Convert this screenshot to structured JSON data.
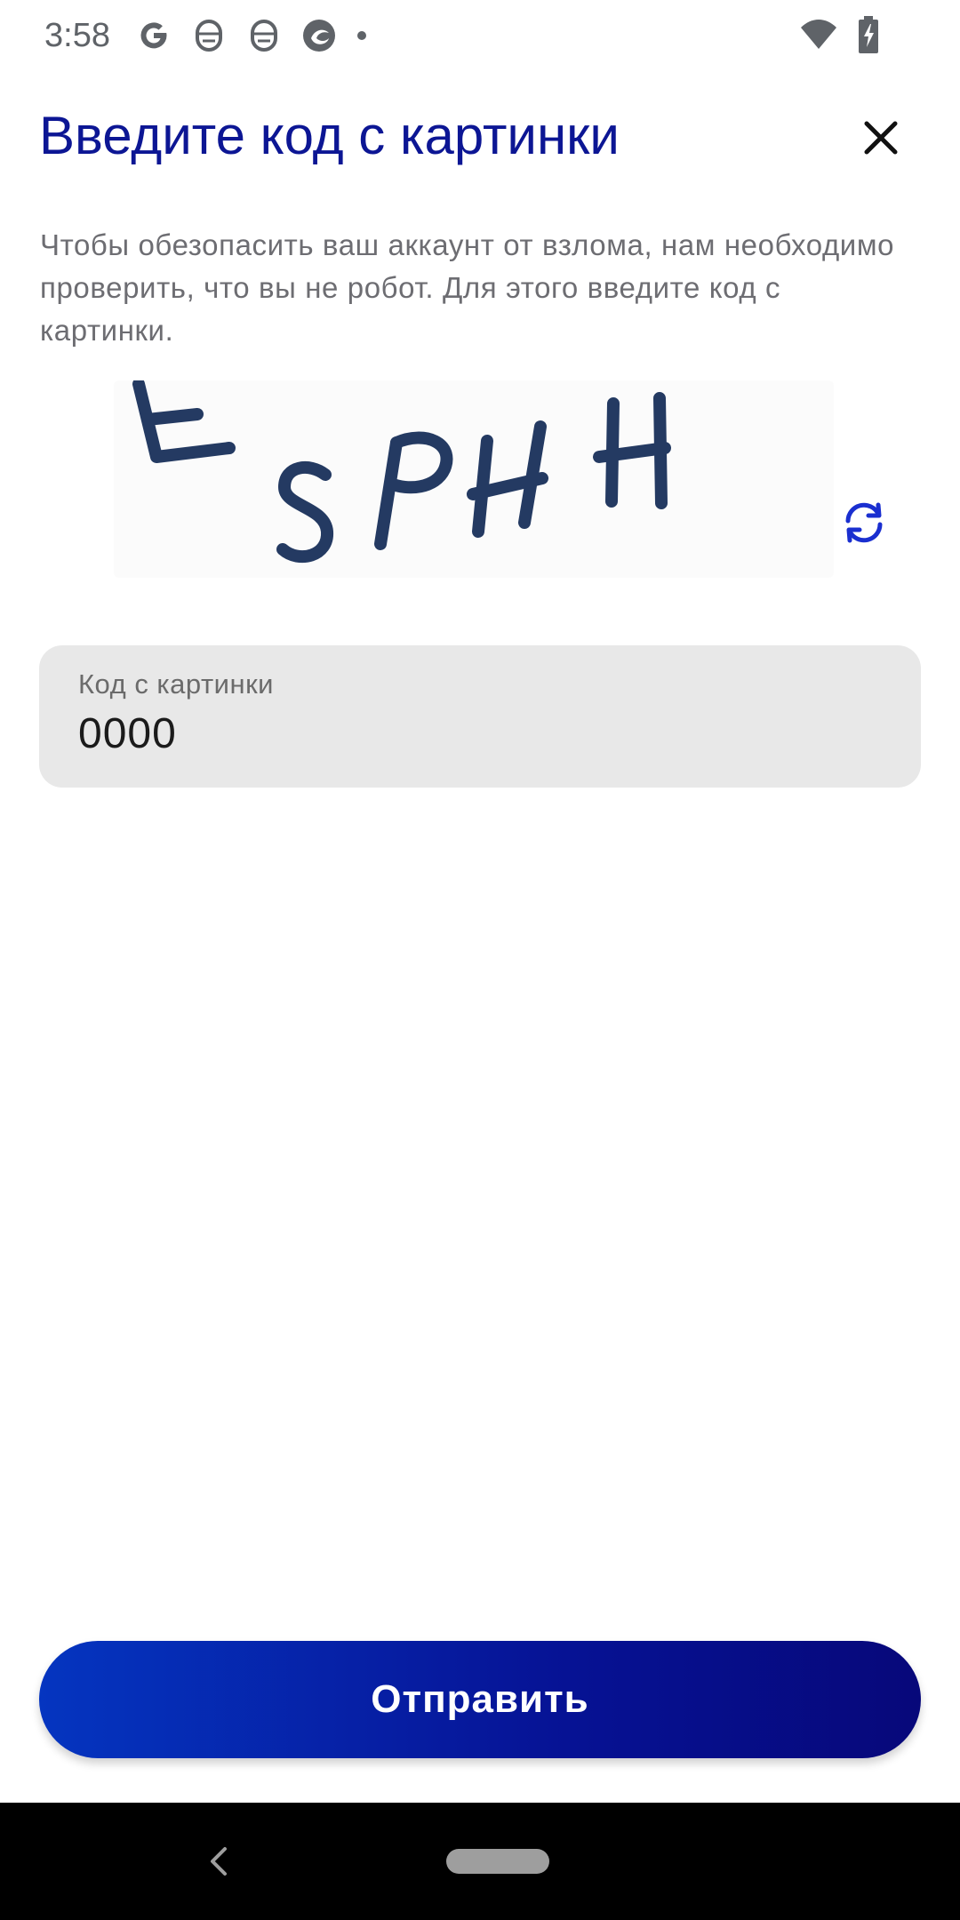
{
  "status_bar": {
    "time": "3:58",
    "icons": [
      "google-icon",
      "notification-icon",
      "notification-icon",
      "browser-icon",
      "dot-icon"
    ],
    "right_icons": [
      "wifi-icon",
      "battery-charging-icon"
    ]
  },
  "dialog": {
    "title": "Введите код с картинки",
    "close_icon": "close-icon",
    "description": "Чтобы обезопасить ваш аккаунт от взлома, нам необходимо проверить, что вы не робот. Для этого введите код с картинки.",
    "refresh_icon": "refresh-icon"
  },
  "captcha": {
    "characters": [
      "E",
      "S",
      "P",
      "H",
      "H"
    ]
  },
  "code_field": {
    "label": "Код с картинки",
    "value": "0000"
  },
  "submit": {
    "label": "Отправить"
  },
  "colors": {
    "title": "#0c1694",
    "accent": "#1a2fd0",
    "button_start": "#0535c0",
    "button_end": "#07087a",
    "captcha_ink": "#243a62"
  }
}
